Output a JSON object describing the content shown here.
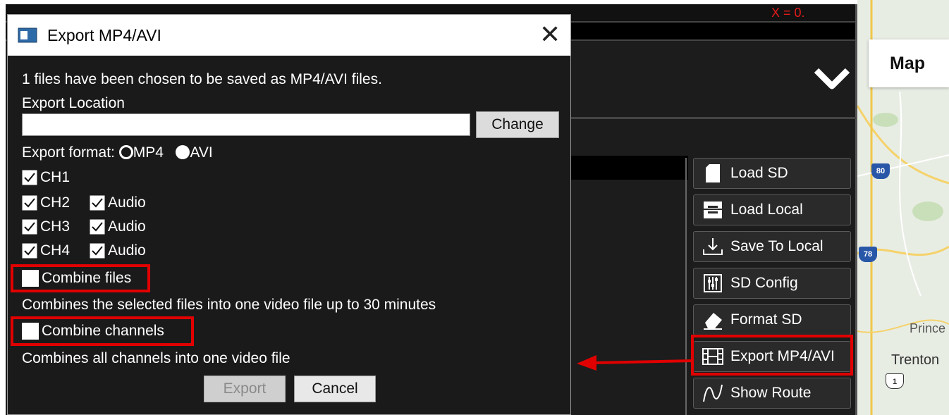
{
  "app": {
    "coord_readout": "X = 0."
  },
  "sidebar": {
    "buttons": [
      {
        "label": "Load SD",
        "icon": "sd-card-icon"
      },
      {
        "label": "Load Local",
        "icon": "folder-stack-icon"
      },
      {
        "label": "Save To Local",
        "icon": "download-icon"
      },
      {
        "label": "SD Config",
        "icon": "sd-config-icon"
      },
      {
        "label": "Format SD",
        "icon": "eraser-icon"
      },
      {
        "label": "Export MP4/AVI",
        "icon": "film-icon"
      },
      {
        "label": "Show Route",
        "icon": "route-icon"
      }
    ]
  },
  "map": {
    "button_label": "Map",
    "city_princeton": "Prince",
    "city_trenton": "Trenton",
    "shield_80": "80",
    "shield_78": "78",
    "shield_1": "1"
  },
  "dialog": {
    "title": "Export MP4/AVI",
    "summary": "1 files have been chosen to be saved as MP4/AVI files.",
    "location_label": "Export Location",
    "location_value": "",
    "change_label": "Change",
    "format_label": "Export format:",
    "format_options": [
      "MP4",
      "AVI"
    ],
    "format_selected": "AVI",
    "channels": [
      {
        "label": "CH1",
        "checked": true,
        "audio": null
      },
      {
        "label": "CH2",
        "checked": true,
        "audio": "Audio"
      },
      {
        "label": "CH3",
        "checked": true,
        "audio": "Audio"
      },
      {
        "label": "CH4",
        "checked": true,
        "audio": "Audio"
      }
    ],
    "combine_files_label": "Combine files",
    "combine_files_checked": false,
    "combine_files_desc": "Combines the selected files into one video file up to 30 minutes",
    "combine_channels_label": "Combine channels",
    "combine_channels_checked": false,
    "combine_channels_desc": "Combines all channels into one video file",
    "export_label": "Export",
    "cancel_label": "Cancel"
  },
  "colors": {
    "highlight": "#e10000",
    "background": "#1a1a1a"
  }
}
